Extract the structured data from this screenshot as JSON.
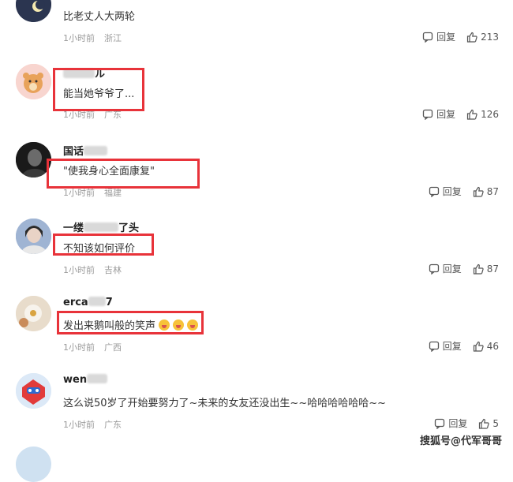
{
  "comments": [
    {
      "name": "",
      "content": "比老丈人大两轮",
      "time": "1小时前",
      "region": "浙江",
      "reply_label": "回复",
      "likes": "213"
    },
    {
      "name": "ル",
      "content": "能当她爷爷了...",
      "time": "1小时前",
      "region": "广东",
      "reply_label": "回复",
      "likes": "126"
    },
    {
      "name": "国话",
      "content": "\"使我身心全面康复\"",
      "time": "1小时前",
      "region": "福建",
      "reply_label": "回复",
      "likes": "87"
    },
    {
      "name": "一缕",
      "name_suffix": "了头",
      "content": "不知该如何评价",
      "time": "1小时前",
      "region": "吉林",
      "reply_label": "回复",
      "likes": "87"
    },
    {
      "name": "erca",
      "name_suffix": "7",
      "content": "发出来鹅叫般的笑声",
      "time": "1小时前",
      "region": "广西",
      "reply_label": "回复",
      "likes": "46"
    },
    {
      "name": "wen",
      "content": "这么说50岁了开始要努力了~未来的女友还没出生~~哈哈哈哈哈哈~~",
      "time": "1小时前",
      "region": "广东",
      "reply_label": "回复",
      "likes": "5"
    }
  ],
  "watermark": "搜狐号@代军哥哥",
  "colors": {
    "highlight": "#e8333a",
    "meta": "#9a9a9a"
  }
}
